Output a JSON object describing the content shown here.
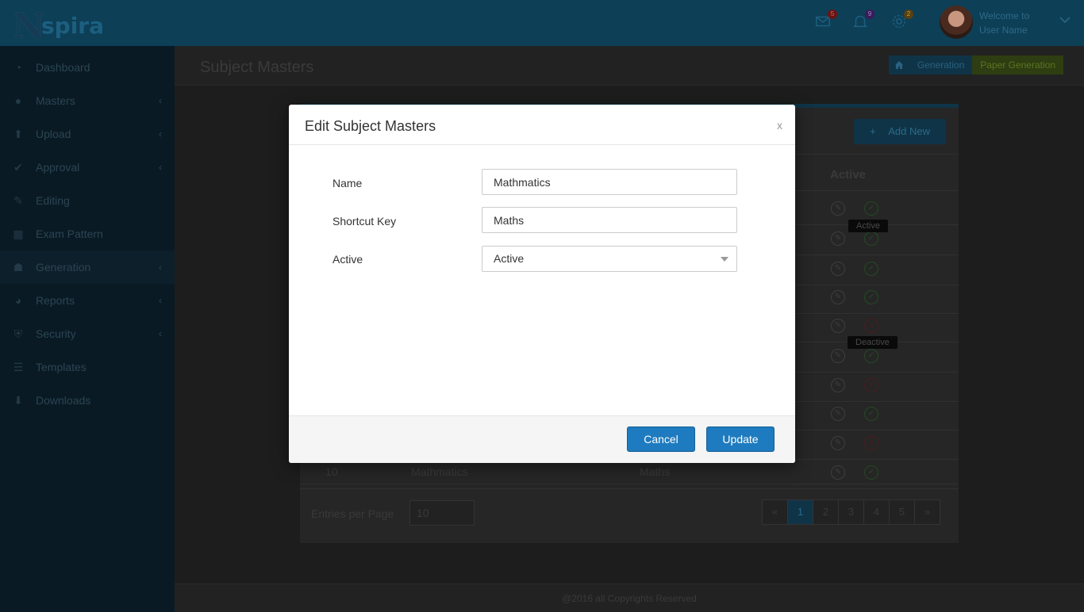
{
  "brand": {
    "logo_text": "spira",
    "logo_mark": "N"
  },
  "topbar": {
    "mail_count": "5",
    "notification_count": "9",
    "settings_count": "2",
    "welcome_line1": "Welcome to",
    "welcome_line2": "User Name"
  },
  "sidebar": {
    "items": [
      {
        "label": "Dashboard",
        "icon": "dashboard-icon"
      },
      {
        "label": "Masters",
        "icon": "users-icon"
      },
      {
        "label": "Upload",
        "icon": "upload-icon"
      },
      {
        "label": "Approval",
        "icon": "check-icon"
      },
      {
        "label": "Editing",
        "icon": "edit-icon"
      },
      {
        "label": "Exam Pattern",
        "icon": "layout-icon"
      },
      {
        "label": "Generation",
        "icon": "group-icon"
      },
      {
        "label": "Reports",
        "icon": "pie-chart-icon"
      },
      {
        "label": "Security",
        "icon": "shield-icon"
      },
      {
        "label": "Templates",
        "icon": "list-icon"
      },
      {
        "label": "Downloads",
        "icon": "download-icon"
      }
    ]
  },
  "page": {
    "title": "Subject Masters",
    "breadcrumb": [
      "Generation",
      "Paper Generation"
    ],
    "add_new_label": "Add New",
    "active_header": "Active",
    "tooltip_active": "Active",
    "tooltip_deactive": "Deactive",
    "last_row": {
      "no": "10",
      "name": "Mathmatics",
      "shortcut": "Maths"
    },
    "row_status": [
      "ok",
      "ok",
      "ok",
      "ok",
      "no",
      "ok",
      "no",
      "ok",
      "no",
      "ok"
    ],
    "entries_label": "Entries per Page",
    "entries_value": "10",
    "pagination": [
      "«",
      "1",
      "2",
      "3",
      "4",
      "5",
      "»"
    ],
    "current_page": "1",
    "footer": "@2016 all Copyrights Reserved"
  },
  "modal": {
    "title": "Edit Subject Masters",
    "close_label": "x",
    "fields": {
      "name_label": "Name",
      "name_value": "Mathmatics",
      "shortcut_label": "Shortcut Key",
      "shortcut_value": "Maths",
      "active_label": "Active",
      "active_value": "Active"
    },
    "cancel_label": "Cancel",
    "update_label": "Update"
  },
  "colors": {
    "primary": "#1e7bbf",
    "topbar": "#0d3f57",
    "sidebar": "#0a1a24"
  }
}
